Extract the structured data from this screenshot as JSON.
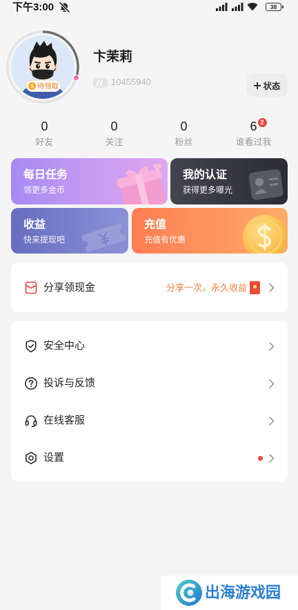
{
  "status_bar": {
    "time": "下午3:00",
    "battery": "38",
    "left_icon": "mute-icon",
    "right_icons": [
      "signal-icon",
      "signal-icon",
      "wifi-icon",
      "battery-icon"
    ]
  },
  "profile": {
    "name": "卞茉莉",
    "id_icon": "id-icon",
    "id_number": "10455940",
    "avatar_badge": "待领取",
    "status_button": "状态",
    "status_button_icon": "plus-icon",
    "ring_progress": 0.3
  },
  "stats": [
    {
      "value": "0",
      "label": "好友"
    },
    {
      "value": "0",
      "label": "关注"
    },
    {
      "value": "0",
      "label": "粉丝"
    },
    {
      "value": "6",
      "label": "谁看过我",
      "badge": "2"
    }
  ],
  "cards": {
    "daily_tasks": {
      "title": "每日任务",
      "subtitle": "领更多金币",
      "icon": "gift-box-icon",
      "gradient": [
        "#a68af2",
        "#c69bf1",
        "#dca7ee"
      ]
    },
    "verification": {
      "title": "我的认证",
      "subtitle": "获得更多曝光",
      "icon": "id-card-icon",
      "gradient": [
        "#44444e",
        "#2c2c35"
      ]
    },
    "earnings": {
      "title": "收益",
      "subtitle": "快来提现吧",
      "icon": "ticket-icon",
      "gradient": [
        "#676cc0",
        "#8d92d7"
      ]
    },
    "recharge": {
      "title": "充值",
      "subtitle": "充值有优惠",
      "icon": "coin-icon",
      "gradient": [
        "#ff7d54",
        "#ffab68"
      ]
    }
  },
  "share": {
    "label": "分享领现金",
    "promo": "分享一次，永久收益",
    "icon": "red-envelope-outline-icon",
    "promo_icon": "red-envelope-icon"
  },
  "menu": [
    {
      "label": "安全中心",
      "icon": "shield-icon",
      "has_dot": false
    },
    {
      "label": "投诉与反馈",
      "icon": "question-circle-icon",
      "has_dot": false
    },
    {
      "label": "在线客服",
      "icon": "headset-icon",
      "has_dot": false
    },
    {
      "label": "设置",
      "icon": "settings-icon",
      "has_dot": true
    }
  ],
  "watermark": {
    "text": "出海游戏园",
    "logo": "chuhai-logo-icon"
  },
  "theme": {
    "background": "#f5f5f5",
    "card_background": "#ffffff",
    "promo_text": "#f0813f",
    "alert_red": "#ee4545",
    "watermark_blue": "#2b7fd3"
  }
}
